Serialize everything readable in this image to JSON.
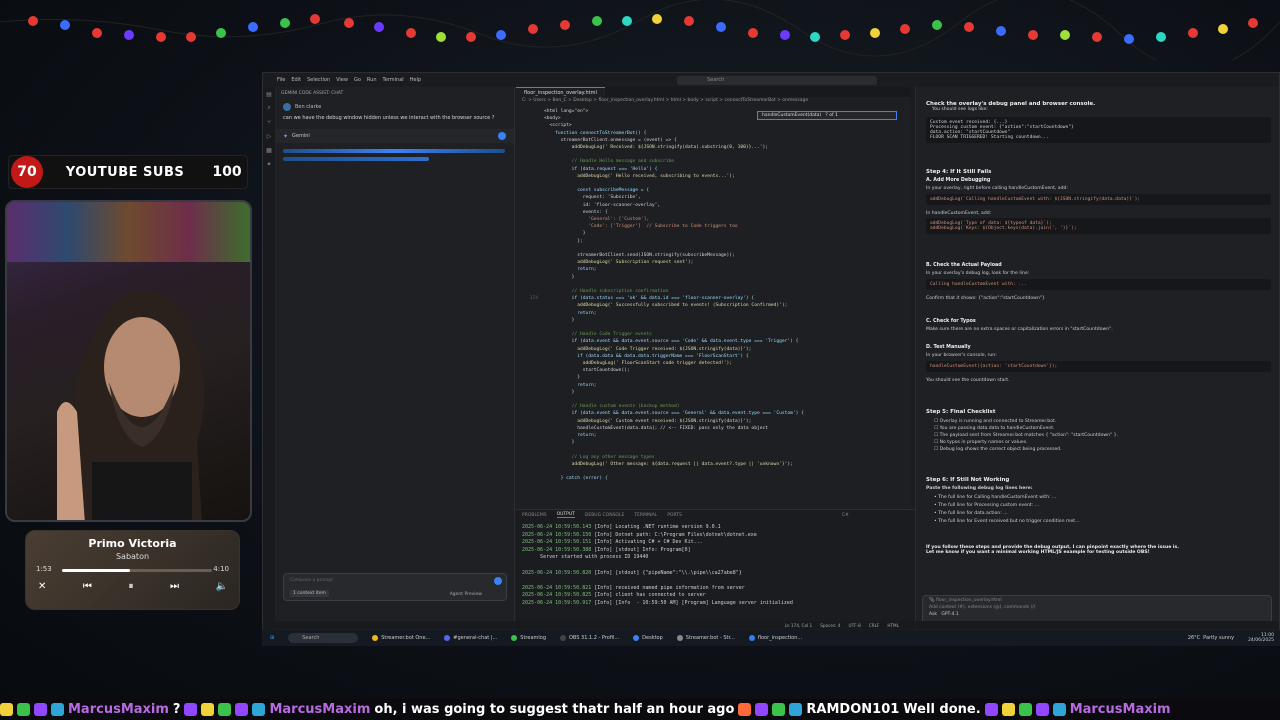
{
  "overlay": {
    "sub_count": "70",
    "sub_label": "YOUTUBE SUBS",
    "sub_goal": "100",
    "song_title": "Primo Victoria",
    "song_artist": "Sabaton",
    "time_elapsed": "1:53",
    "time_total": "4:10",
    "song_progress": 0.45
  },
  "ide": {
    "menu": [
      "File",
      "Edit",
      "Selection",
      "View",
      "Go",
      "Run",
      "Terminal",
      "Help"
    ],
    "command_search": "Search",
    "chat_pane_title": "GEMINI CODE ASSIST: CHAT",
    "user_name": "Ben clarke",
    "user_question": "can we have the debug window hidden unless we interact with the browser source ?",
    "assistant_name": "Gemini",
    "chat_placeholder": "Compose a prompt",
    "context_chip": "1 context item",
    "agent_label": "Agent",
    "preview_label": "Preview",
    "editor_tab": "floor_inspection_overlay.html",
    "breadcrumb": "C: > Users > Ben_C > Desktop > floor_inspection_overlay.html > html > body > script > connectToStreamerBot > onmessage",
    "find_text": "handleCustomEvent(data)",
    "find_count": "? of 1"
  },
  "code_lines": [
    {
      "n": "",
      "t": "<html lang=\"en\">"
    },
    {
      "n": "",
      "t": "<body>"
    },
    {
      "n": "",
      "t": "  <script>"
    },
    {
      "n": "",
      "t": "    function connectToStreamerBot() {"
    },
    {
      "n": "",
      "t": "      streamerBotClient.onmessage = (event) => {"
    },
    {
      "n": "",
      "t": "          addDebugLog(' Received: ${JSON.stringify(data).substring(0, 100)}...');"
    },
    {
      "n": "",
      "t": ""
    },
    {
      "n": "",
      "t": "          // Handle Hello message and subscribe"
    },
    {
      "n": "",
      "t": "          if (data.request === 'Hello') {"
    },
    {
      "n": "",
      "t": "            addDebugLog(' Hello received, subscribing to events...');"
    },
    {
      "n": "",
      "t": ""
    },
    {
      "n": "",
      "t": "            const subscribeMessage = {"
    },
    {
      "n": "",
      "t": "              request: 'Subscribe',"
    },
    {
      "n": "",
      "t": "              id: 'floor-scanner-overlay',"
    },
    {
      "n": "",
      "t": "              events: {"
    },
    {
      "n": "",
      "t": "                'General': ['Custom'],"
    },
    {
      "n": "",
      "t": "                'Code': ['Trigger']  // Subscribe to Code triggers too"
    },
    {
      "n": "",
      "t": "              }"
    },
    {
      "n": "",
      "t": "            };"
    },
    {
      "n": "",
      "t": ""
    },
    {
      "n": "",
      "t": "            streamerBotClient.send(JSON.stringify(subscribeMessage));"
    },
    {
      "n": "",
      "t": "            addDebugLog(' Subscription request sent');"
    },
    {
      "n": "",
      "t": "            return;"
    },
    {
      "n": "",
      "t": "          }"
    },
    {
      "n": "",
      "t": ""
    },
    {
      "n": "",
      "t": "          // Handle subscription confirmation"
    },
    {
      "n": "174",
      "t": "          if (data.status === 'ok' && data.id === 'floor-scanner-overlay') {"
    },
    {
      "n": "",
      "t": "            addDebugLog(' Successfully subscribed to events! (Subscription Confirmed)');"
    },
    {
      "n": "",
      "t": "            return;"
    },
    {
      "n": "",
      "t": "          }"
    },
    {
      "n": "",
      "t": ""
    },
    {
      "n": "",
      "t": "          // Handle Code Trigger events"
    },
    {
      "n": "",
      "t": "          if (data.event && data.event.source === 'Code' && data.event.type === 'Trigger') {"
    },
    {
      "n": "",
      "t": "            addDebugLog(' Code Trigger received: ${JSON.stringify(data)}');"
    },
    {
      "n": "",
      "t": "            if (data.data && data.data.triggerName === 'FloorScanStart') {"
    },
    {
      "n": "",
      "t": "              addDebugLog(' FloorScanStart code trigger detected!');"
    },
    {
      "n": "",
      "t": "              startCountdown();"
    },
    {
      "n": "",
      "t": "            }"
    },
    {
      "n": "",
      "t": "            return;"
    },
    {
      "n": "",
      "t": "          }"
    },
    {
      "n": "",
      "t": ""
    },
    {
      "n": "",
      "t": "          // Handle custom events (backup method)"
    },
    {
      "n": "",
      "t": "          if (data.event && data.event.source === 'General' && data.event.type === 'Custom') {"
    },
    {
      "n": "",
      "t": "            addDebugLog(' Custom event received: ${JSON.stringify(data)}');"
    },
    {
      "n": "",
      "t": "            handleCustomEvent(data.data); // <-- FIXED: pass only the data object"
    },
    {
      "n": "",
      "t": "            return;"
    },
    {
      "n": "",
      "t": "          }"
    },
    {
      "n": "",
      "t": ""
    },
    {
      "n": "",
      "t": "          // Log any other message types"
    },
    {
      "n": "",
      "t": "          addDebugLog(' Other message: ${data.request || data.event?.type || 'unknown'}');"
    },
    {
      "n": "",
      "t": ""
    },
    {
      "n": "",
      "t": "      } catch (error) {"
    }
  ],
  "panel": {
    "tabs": [
      "PROBLEMS",
      "OUTPUT",
      "DEBUG CONSOLE",
      "TERMINAL",
      "PORTS"
    ],
    "filter": "C#",
    "lines": [
      {
        "ts": "2025-06-24 10:59:50.143",
        "msg": "[Info] Locating .NET runtime version 9.0.1"
      },
      {
        "ts": "2025-06-24 10:59:50.150",
        "msg": "[Info] Dotnet path: C:\\Program Files\\dotnet\\dotnet.exe"
      },
      {
        "ts": "2025-06-24 10:59:50.151",
        "msg": "[Info] Activating C# + C# Dev Kit..."
      },
      {
        "ts": "2025-06-24 10:59:50.388",
        "msg": "[Info] [stdout] Info: Program[0]"
      },
      {
        "ts": "",
        "msg": "      Server started with process ID 19440"
      },
      {
        "ts": "",
        "msg": ""
      },
      {
        "ts": "2025-06-24 10:59:50.820",
        "msg": "[Info] [stdout] {\"pipeName\":\"\\\\.\\pipe\\\\ca27abe8\"}"
      },
      {
        "ts": "",
        "msg": ""
      },
      {
        "ts": "2025-06-24 10:59:50.821",
        "msg": "[Info] received named pipe information from server"
      },
      {
        "ts": "2025-06-24 10:59:50.825",
        "msg": "[Info] client has connected to server"
      },
      {
        "ts": "2025-06-24 10:59:50.917",
        "msg": "[Info] [Info  - 10:59:50 AM] [Program] Language server initialized"
      }
    ]
  },
  "right_chat": {
    "intro": "Check the overlay's debug panel and browser console.",
    "intro2": "You should see logs like:",
    "logs": [
      "Custom event received: {...}",
      "Processing custom event: {\"action\":\"startCountdown\"}",
      "data.action: \"startCountdown\"",
      "FLOOR SCAN TRIGGERED! Starting countdown..."
    ],
    "step4": "Step 4: If It Still Fails",
    "a_title": "A. Add More Debugging",
    "a_text": "In your overlay, right before calling handleCustomEvent, add:",
    "a_code": "addDebugLog(`Calling handleCustomEvent with: ${JSON.stringify(data.data)}`);",
    "a_text2": "In handleCustomEvent, add:",
    "a_code2": "addDebugLog(`Type of data: ${typeof data}`);",
    "a_code3": "addDebugLog(`Keys: ${Object.keys(data).join(', ')}`);",
    "b_title": "B. Check the Actual Payload",
    "b_text": "In your overlay's debug log, look for the line:",
    "b_code": "Calling handleCustomEvent with: ...",
    "b_text2": "Confirm that it shows: {\"action\":\"startCountdown\"}",
    "c_title": "C. Check for Typos",
    "c_text": "Make sure there are no extra spaces or capitalization errors in \"startCountdown\".",
    "d_title": "D. Test Manually",
    "d_text": "In your browser's console, run:",
    "d_code": "handleCustomEvent({action: 'startCountdown'});",
    "d_text2": "You should see the countdown start.",
    "step5": "Step 5: Final Checklist",
    "checklist": [
      "Overlay is running and connected to Streamer.bot.",
      "You are passing data.data to handleCustomEvent.",
      "The payload sent from Streamer.bot matches { \"action\": \"startCountdown\" }.",
      "No typos in property names or values.",
      "Debug log shows the correct object being processed."
    ],
    "step6": "Step 6: If Still Not Working",
    "step6_text": "Paste the following debug log lines here:",
    "step6_items": [
      "The full line for Calling handleCustomEvent with: ...",
      "The full line for Processing custom event: ...",
      "The full line for data.action: ...",
      "The full line for Event received but no trigger condition met..."
    ],
    "outro": "If you follow these steps and provide the debug output, I can pinpoint exactly where the issue is.",
    "outro2": "Let me know if you want a minimal working HTML/JS example for testing outside OBS!",
    "input_chip": "floor_inspection_overlay.html",
    "input_placeholder": "Add context (#), extensions (@), commands (/)",
    "mode": "Ask",
    "model": "GPT-4.1"
  },
  "taskbar": {
    "search": "Search",
    "apps": [
      "Streamer.bot One...",
      "#general-chat |...",
      "Streamlog",
      "OBS 31.1.2 - Profil...",
      "Desktop",
      "Streamer.bot - Str...",
      "floor_inspection..."
    ],
    "weather": "26°C",
    "weather_desc": "Partly sunny",
    "time": "11:00",
    "date": "24/06/2025"
  },
  "status": {
    "position": "Ln 174, Col 1",
    "spaces": "Spaces: 4",
    "encoding": "UTF-8",
    "eol": "CRLF",
    "lang": "HTML"
  },
  "ticker": {
    "user1": "MarcusMaxim",
    "msg1": "?",
    "user2": "MarcusMaxim",
    "msg2": "oh, i was going to suggest thatr half an hour ago",
    "user3": "RAMDON101",
    "msg3": "Well done.",
    "user4": "MarcusMaxim",
    "msg4": "",
    "name_color": "#b66ce0",
    "name_color2": "#ffffff"
  }
}
